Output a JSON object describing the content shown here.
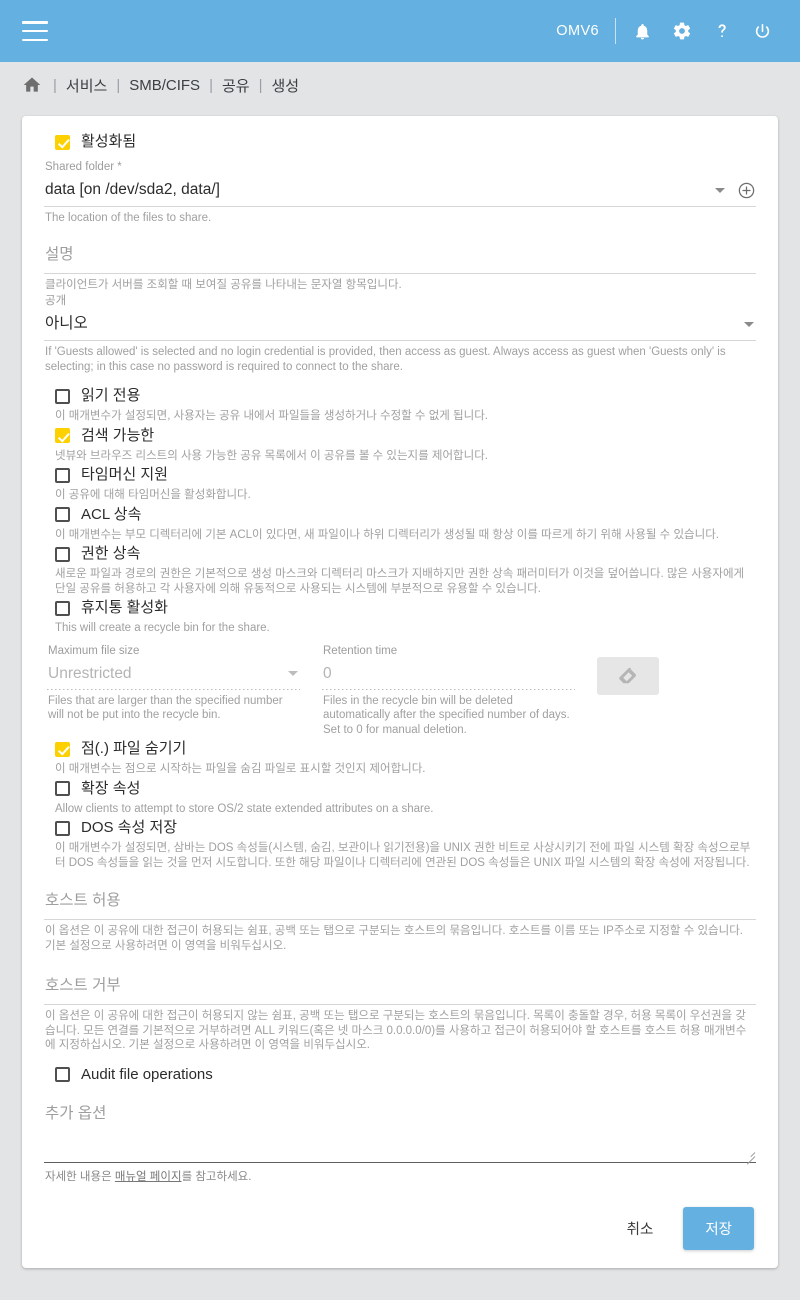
{
  "appbar": {
    "menu_icon": "hamburger-menu-icon",
    "hostname": "OMV6",
    "icons": [
      "bell-icon",
      "gear-icon",
      "question-mark-icon",
      "power-icon"
    ],
    "background_color": "#64b0e0"
  },
  "breadcrumb": {
    "home_icon": "home-icon",
    "separator": "|",
    "items": [
      {
        "label": "서비스"
      },
      {
        "label": "SMB/CIFS"
      },
      {
        "label": "공유"
      },
      {
        "label": "생성"
      }
    ]
  },
  "form": {
    "enabled": {
      "label": "활성화됨",
      "checked": true
    },
    "shared_folder": {
      "label": "Shared folder *",
      "value": "data [on /dev/sda2, data/]",
      "hint": "The location of the files to share.",
      "dropdown_icon": "chevron-down-icon",
      "add_icon": "plus-circle-icon"
    },
    "description": {
      "placeholder": "설명",
      "value": "",
      "hint": "클라이언트가 서버를 조회할 때 보여질 공유를 나타내는 문자열 항목입니다."
    },
    "public": {
      "label": "공개",
      "value": "아니오",
      "hint": "If 'Guests allowed' is selected and no login credential is provided, then access as guest. Always access as guest when 'Guests only' is selecting; in this case no password is required to connect to the share.",
      "dropdown_icon": "chevron-down-icon"
    },
    "checkboxes": [
      {
        "name": "read-only",
        "label": "읽기 전용",
        "checked": false,
        "hint": "이 매개변수가 설정되면, 사용자는 공유 내에서 파일들을 생성하거나 수정할 수 없게 됩니다."
      },
      {
        "name": "browseable",
        "label": "검색 가능한",
        "checked": true,
        "hint": "넷뷰와 브라우즈 리스트의 사용 가능한 공유 목록에서 이 공유를 볼 수 있는지를 제어합니다."
      },
      {
        "name": "time-machine-support",
        "label": "타임머신 지원",
        "checked": false,
        "hint": "이 공유에 대해 타임머신을 활성화합니다."
      },
      {
        "name": "inherit-acls",
        "label": "ACL 상속",
        "checked": false,
        "hint": "이 매개변수는 부모 디렉터리에 기본 ACL이 있다면, 새 파일이나 하위 디렉터리가 생성될 때 항상 이를 따르게 하기 위해 사용될 수 있습니다."
      },
      {
        "name": "inherit-permissions",
        "label": "권한 상속",
        "checked": false,
        "hint": "새로운 파일과 경로의 권한은 기본적으로 생성 마스크와 디렉터리 마스크가 지배하지만 권한 상속 패러미터가 이것을 덮어씁니다. 많은 사용자에게 단일 공유를 허용하고 각 사용자에 의해 유동적으로 사용되는 시스템에 부분적으로 유용할 수 있습니다."
      },
      {
        "name": "recycle-bin",
        "label": "휴지통 활성화",
        "checked": false,
        "hint": "This will create a recycle bin for the share."
      }
    ],
    "recycle_bin": {
      "max_file_size": {
        "label": "Maximum file size",
        "value": "Unrestricted",
        "hint": "Files that are larger than the specified number will not be put into the recycle bin.",
        "disabled": true,
        "dropdown_icon": "chevron-down-icon"
      },
      "retention_time": {
        "label": "Retention time",
        "value": "0",
        "hint": "Files in the recycle bin will be deleted automatically after the specified number of days. Set to 0 for manual deletion.",
        "disabled": true
      },
      "clear_button": {
        "icon": "eraser-icon",
        "disabled": true
      }
    },
    "checkboxes2": [
      {
        "name": "hide-dot-files",
        "label": "점(.) 파일 숨기기",
        "checked": true,
        "hint": "이 매개변수는 점으로 시작하는 파일을 숨김 파일로 표시할 것인지 제어합니다."
      },
      {
        "name": "extended-attributes",
        "label": "확장 속성",
        "checked": false,
        "hint": "Allow clients to attempt to store OS/2 state extended attributes on a share."
      },
      {
        "name": "store-dos-attributes",
        "label": "DOS 속성 저장",
        "checked": false,
        "hint": "이 매개변수가 설정되면, 삼바는 DOS 속성들(시스템, 숨김, 보관이나 읽기전용)을 UNIX 권한 비트로 사상시키기 전에 파일 시스템 확장 속성으로부터 DOS 속성들을 읽는 것을 먼저 시도합니다. 또한 해당 파일이나 디렉터리에 연관된 DOS 속성들은 UNIX 파일 시스템의 확장 속성에 저장됩니다."
      }
    ],
    "hosts_allow": {
      "placeholder": "호스트 허용",
      "value": "",
      "hint": "이 옵션은 이 공유에 대한 접근이 허용되는 쉼표, 공백 또는 탭으로 구분되는 호스트의 묶음입니다. 호스트를 이름 또는 IP주소로 지정할 수 있습니다. 기본 설정으로 사용하려면 이 영역을 비워두십시오."
    },
    "hosts_deny": {
      "placeholder": "호스트 거부",
      "value": "",
      "hint": "이 옵션은 이 공유에 대한 접근이 허용되지 않는 쉼표, 공백 또는 탭으로 구분되는 호스트의 묶음입니다. 목록이 충돌할 경우, 허용 목록이 우선권을 갖습니다. 모든 연결를 기본적으로 거부하려면 ALL 키워드(혹은 넷 마스크 0.0.0.0/0)를 사용하고 접근이 허용되어야 할 호스트를 호스트 허용 매개변수에 지정하십시오. 기본 설정으로 사용하려면 이 영역을 비워두십시오."
    },
    "audit_file_operations": {
      "label": "Audit file operations",
      "checked": false
    },
    "extra_options": {
      "placeholder": "추가 옵션",
      "value": "",
      "note_prefix": "자세한 내용은 ",
      "note_link": "매뉴얼 페이지",
      "note_suffix": "를 참고하세요."
    }
  },
  "actions": {
    "cancel_label": "취소",
    "save_label": "저장",
    "primary_color": "#64b0e0"
  }
}
